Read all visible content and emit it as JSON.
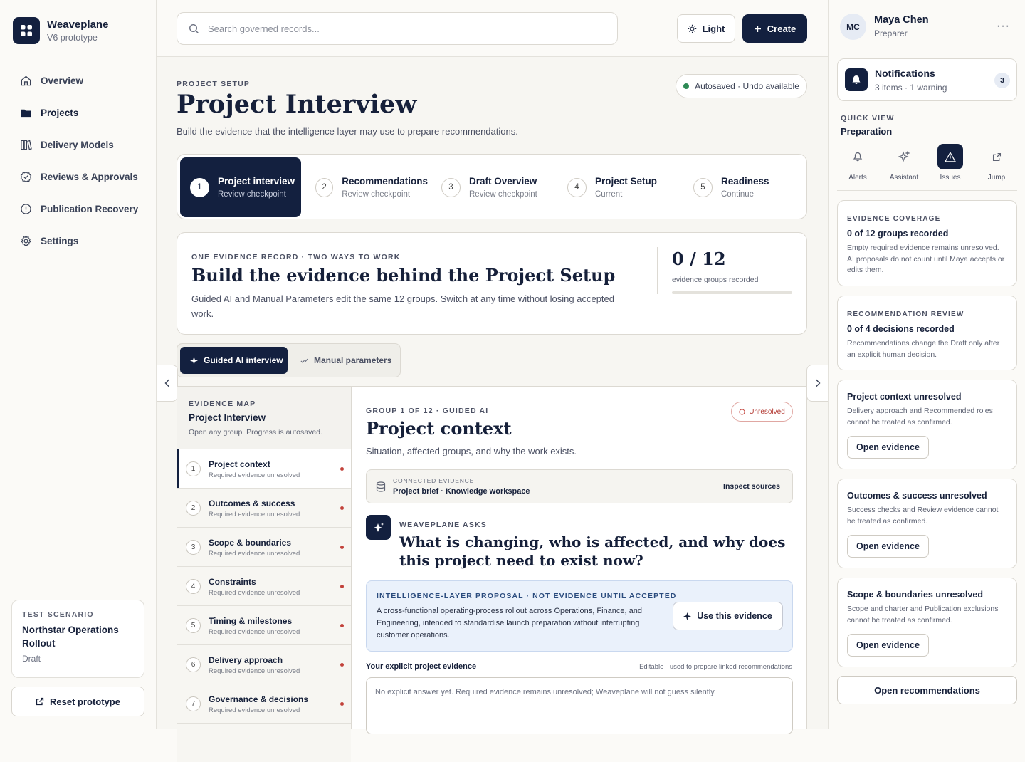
{
  "app": {
    "name": "Weaveplane",
    "version": "V6 prototype"
  },
  "nav": [
    {
      "label": "Overview",
      "icon": "home-icon"
    },
    {
      "label": "Projects",
      "icon": "folder-icon",
      "active": true
    },
    {
      "label": "Delivery Models",
      "icon": "books-icon"
    },
    {
      "label": "Reviews & Approvals",
      "icon": "check-badge-icon"
    },
    {
      "label": "Publication Recovery",
      "icon": "alert-circle-icon"
    },
    {
      "label": "Settings",
      "icon": "gear-icon"
    }
  ],
  "scenario": {
    "eyebrow": "TEST SCENARIO",
    "title": "Northstar Operations Rollout",
    "status": "Draft",
    "reset_label": "Reset prototype"
  },
  "topbar": {
    "search_placeholder": "Search governed records...",
    "theme_label": "Light",
    "create_label": "Create"
  },
  "page": {
    "eyebrow": "PROJECT SETUP",
    "title": "Project Interview",
    "subtitle": "Build the evidence that the intelligence layer may use to prepare recommendations.",
    "autosave": "Autosaved · Undo available"
  },
  "steps": [
    {
      "num": "1",
      "label": "Project interview",
      "sub": "Review checkpoint",
      "active": true
    },
    {
      "num": "2",
      "label": "Recommendations",
      "sub": "Review checkpoint"
    },
    {
      "num": "3",
      "label": "Draft Overview",
      "sub": "Review checkpoint"
    },
    {
      "num": "4",
      "label": "Project Setup",
      "sub": "Current"
    },
    {
      "num": "5",
      "label": "Readiness",
      "sub": "Continue"
    }
  ],
  "hero": {
    "eyebrow": "ONE EVIDENCE RECORD · TWO WAYS TO WORK",
    "title": "Build the evidence behind the Project Setup",
    "desc": "Guided AI and Manual Parameters edit the same 12 groups. Switch at any time without losing accepted work.",
    "count": "0 / 12",
    "count_label": "evidence groups recorded",
    "progress": 0
  },
  "modes": {
    "guided": "Guided AI interview",
    "manual": "Manual parameters"
  },
  "evidence_map": {
    "eyebrow": "EVIDENCE MAP",
    "title": "Project Interview",
    "sub": "Open any group. Progress is autosaved.",
    "items": [
      {
        "num": "1",
        "title": "Project context",
        "status": "Required evidence unresolved",
        "active": true
      },
      {
        "num": "2",
        "title": "Outcomes & success",
        "status": "Required evidence unresolved"
      },
      {
        "num": "3",
        "title": "Scope & boundaries",
        "status": "Required evidence unresolved"
      },
      {
        "num": "4",
        "title": "Constraints",
        "status": "Required evidence unresolved"
      },
      {
        "num": "5",
        "title": "Timing & milestones",
        "status": "Required evidence unresolved"
      },
      {
        "num": "6",
        "title": "Delivery approach",
        "status": "Required evidence unresolved"
      },
      {
        "num": "7",
        "title": "Governance & decisions",
        "status": "Required evidence unresolved"
      }
    ]
  },
  "group": {
    "eyebrow": "GROUP 1 OF 12 · GUIDED AI",
    "status": "Unresolved",
    "title": "Project context",
    "sub": "Situation, affected groups, and why the work exists.",
    "connected_label": "CONNECTED EVIDENCE",
    "connected_value": "Project brief · Knowledge workspace",
    "inspect_label": "Inspect sources",
    "asks_label": "WEAVEPLANE ASKS",
    "question": "What is changing, who is affected, and why does this project need to exist now?",
    "proposal_label": "INTELLIGENCE-LAYER PROPOSAL · NOT EVIDENCE UNTIL ACCEPTED",
    "proposal_text": "A cross-functional operating-process rollout across Operations, Finance, and Engineering, intended to standardise launch preparation without interrupting customer operations.",
    "use_label": "Use this evidence",
    "evidence_label": "Your explicit project evidence",
    "evidence_hint": "Editable · used to prepare linked recommendations",
    "evidence_placeholder": "No explicit answer yet. Required evidence remains unresolved; Weaveplane will not guess silently."
  },
  "user": {
    "initials": "MC",
    "name": "Maya Chen",
    "role": "Preparer"
  },
  "notifications": {
    "title": "Notifications",
    "sub": "3 items · 1 warning",
    "count": "3"
  },
  "quick_view": {
    "eyebrow": "QUICK VIEW",
    "title": "Preparation",
    "items": [
      {
        "label": "Alerts",
        "icon": "bell-icon"
      },
      {
        "label": "Assistant",
        "icon": "sparkle-icon"
      },
      {
        "label": "Issues",
        "icon": "warning-icon",
        "active": true
      },
      {
        "label": "Jump",
        "icon": "external-link-icon"
      }
    ]
  },
  "cards": {
    "coverage": {
      "eyebrow": "EVIDENCE COVERAGE",
      "title": "0 of 12 groups recorded",
      "desc": "Empty required evidence remains unresolved. AI proposals do not count until Maya accepts or edits them."
    },
    "review": {
      "eyebrow": "RECOMMENDATION REVIEW",
      "title": "0 of 4 decisions recorded",
      "desc": "Recommendations change the Draft only after an explicit human decision."
    },
    "issues": [
      {
        "title": "Project context unresolved",
        "desc": "Delivery approach and Recommended roles cannot be treated as confirmed.",
        "button": "Open evidence"
      },
      {
        "title": "Outcomes & success unresolved",
        "desc": "Success checks and Review evidence cannot be treated as confirmed.",
        "button": "Open evidence"
      },
      {
        "title": "Scope & boundaries unresolved",
        "desc": "Scope and charter and Publication exclusions cannot be treated as confirmed.",
        "button": "Open evidence"
      }
    ],
    "open_recs": "Open recommendations"
  },
  "colors": {
    "navy": "#13203f",
    "warn": "#c2423b",
    "ok": "#2e8a55",
    "proposal_bg": "#eaf1fb"
  }
}
